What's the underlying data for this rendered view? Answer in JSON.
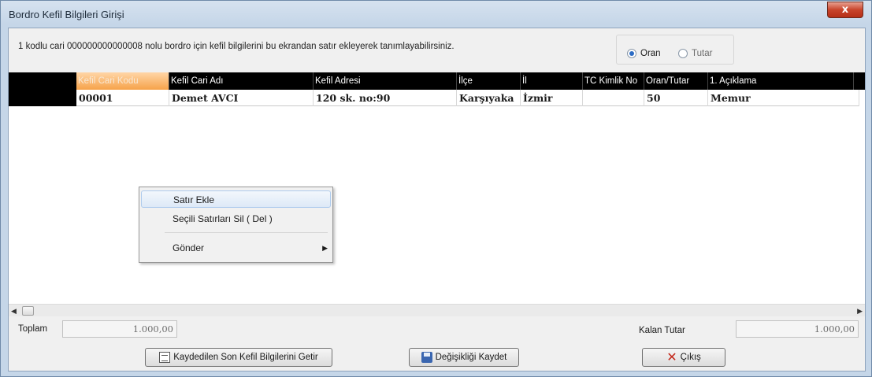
{
  "window": {
    "title": "Bordro Kefil Bilgileri Girişi",
    "close_glyph": "x"
  },
  "info_text": "1 kodlu cari 000000000000008 nolu bordro için kefil bilgilerini bu ekrandan satır ekleyerek tanımlayabilirsiniz.",
  "mode": {
    "options": [
      "Oran",
      "Tutar"
    ],
    "selected": "Oran"
  },
  "grid": {
    "columns": [
      "Kefil Cari Kodu",
      "Kefil Cari Adı",
      "Kefil Adresi",
      "İlçe",
      "İl",
      "TC Kimlik No",
      "Oran/Tutar",
      "1. Açıklama"
    ],
    "rows": [
      {
        "kod": "00001",
        "ad": "Demet AVCI",
        "adres": "120 sk. no:90",
        "ilce": "Karşıyaka",
        "il": "İzmir",
        "tc": "",
        "oran": "50",
        "aciklama": "Memur"
      }
    ]
  },
  "context_menu": {
    "items": [
      "Satır Ekle",
      "Seçili Satırları Sil ( Del )",
      "Gönder"
    ],
    "highlighted": "Satır Ekle"
  },
  "totals": {
    "toplam_label": "Toplam",
    "toplam_value": "1.000,00",
    "kalan_label": "Kalan Tutar",
    "kalan_value": "1.000,00"
  },
  "buttons": {
    "getir": "Kaydedilen Son Kefil Bilgilerini Getir",
    "kaydet": "Değişikliği Kaydet",
    "cikis": "Çıkış"
  },
  "icons": [
    "close-icon",
    "document-icon",
    "save-icon",
    "x-icon",
    "submenu-arrow-icon"
  ]
}
